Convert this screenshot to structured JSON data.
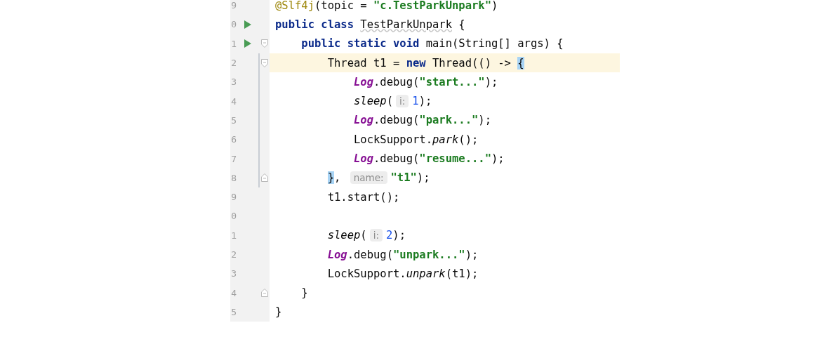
{
  "editor": {
    "lines": [
      {
        "number": "9",
        "tokens": [
          {
            "kind": "annotation",
            "text": "@Slf4j"
          },
          {
            "kind": "plain",
            "text": "(topic = "
          },
          {
            "kind": "string",
            "text": "\"c.TestParkUnpark\""
          },
          {
            "kind": "plain",
            "text": ")"
          }
        ]
      },
      {
        "number": "0",
        "run": true,
        "tokens": [
          {
            "kind": "keyword",
            "text": "public class "
          },
          {
            "kind": "warning",
            "text": "TestParkUnpark"
          },
          {
            "kind": "plain",
            "text": " {"
          }
        ]
      },
      {
        "number": "1",
        "run": true,
        "fold_start": true,
        "tokens": [
          {
            "kind": "keyword",
            "text": "    public static void "
          },
          {
            "kind": "plain",
            "text": "main(String[] args) {"
          }
        ]
      },
      {
        "number": "2",
        "fold_start": true,
        "modified": true,
        "current": true,
        "tokens": [
          {
            "kind": "plain",
            "text": "        Thread t1 = "
          },
          {
            "kind": "keyword",
            "text": "new"
          },
          {
            "kind": "plain",
            "text": " Thread(() -> "
          },
          {
            "kind": "brace",
            "text": "{"
          }
        ]
      },
      {
        "number": "3",
        "modified": true,
        "tokens": [
          {
            "kind": "field",
            "text": "            Log"
          },
          {
            "kind": "plain",
            "text": ".debug("
          },
          {
            "kind": "string",
            "text": "\"start...\""
          },
          {
            "kind": "plain",
            "text": ");"
          }
        ]
      },
      {
        "number": "4",
        "modified": true,
        "tokens": [
          {
            "kind": "static",
            "text": "            sleep"
          },
          {
            "kind": "plain",
            "text": "("
          },
          {
            "kind": "hint",
            "text": "i:"
          },
          {
            "kind": "number",
            "text": "1"
          },
          {
            "kind": "plain",
            "text": ");"
          }
        ]
      },
      {
        "number": "5",
        "modified": true,
        "tokens": [
          {
            "kind": "field",
            "text": "            Log"
          },
          {
            "kind": "plain",
            "text": ".debug("
          },
          {
            "kind": "string",
            "text": "\"park...\""
          },
          {
            "kind": "plain",
            "text": ");"
          }
        ]
      },
      {
        "number": "6",
        "modified": true,
        "tokens": [
          {
            "kind": "plain",
            "text": "            LockSupport."
          },
          {
            "kind": "static",
            "text": "park"
          },
          {
            "kind": "plain",
            "text": "();"
          }
        ]
      },
      {
        "number": "7",
        "modified": true,
        "tokens": [
          {
            "kind": "field",
            "text": "            Log"
          },
          {
            "kind": "plain",
            "text": ".debug("
          },
          {
            "kind": "string",
            "text": "\"resume...\""
          },
          {
            "kind": "plain",
            "text": ");"
          }
        ]
      },
      {
        "number": "8",
        "fold_end": true,
        "modified": true,
        "tokens": [
          {
            "kind": "brace",
            "text": "        }"
          },
          {
            "kind": "plain",
            "text": ", "
          },
          {
            "kind": "hint",
            "text": "name:"
          },
          {
            "kind": "string",
            "text": "\"t1\""
          },
          {
            "kind": "plain",
            "text": ");"
          }
        ]
      },
      {
        "number": "9",
        "tokens": [
          {
            "kind": "plain",
            "text": "        t1.start();"
          }
        ]
      },
      {
        "number": "0"
      },
      {
        "number": "1",
        "tokens": [
          {
            "kind": "static",
            "text": "        sleep"
          },
          {
            "kind": "plain",
            "text": "("
          },
          {
            "kind": "hint",
            "text": "i:"
          },
          {
            "kind": "number",
            "text": "2"
          },
          {
            "kind": "plain",
            "text": ");"
          }
        ]
      },
      {
        "number": "2",
        "tokens": [
          {
            "kind": "field",
            "text": "        Log"
          },
          {
            "kind": "plain",
            "text": ".debug("
          },
          {
            "kind": "string",
            "text": "\"unpark...\""
          },
          {
            "kind": "plain",
            "text": ");"
          }
        ]
      },
      {
        "number": "3",
        "tokens": [
          {
            "kind": "plain",
            "text": "        LockSupport."
          },
          {
            "kind": "static",
            "text": "unpark"
          },
          {
            "kind": "plain",
            "text": "(t1);"
          }
        ]
      },
      {
        "number": "4",
        "fold_end": true,
        "tokens": [
          {
            "kind": "plain",
            "text": "    }"
          }
        ]
      },
      {
        "number": "5",
        "tokens": [
          {
            "kind": "plain",
            "text": "}"
          }
        ]
      }
    ]
  }
}
